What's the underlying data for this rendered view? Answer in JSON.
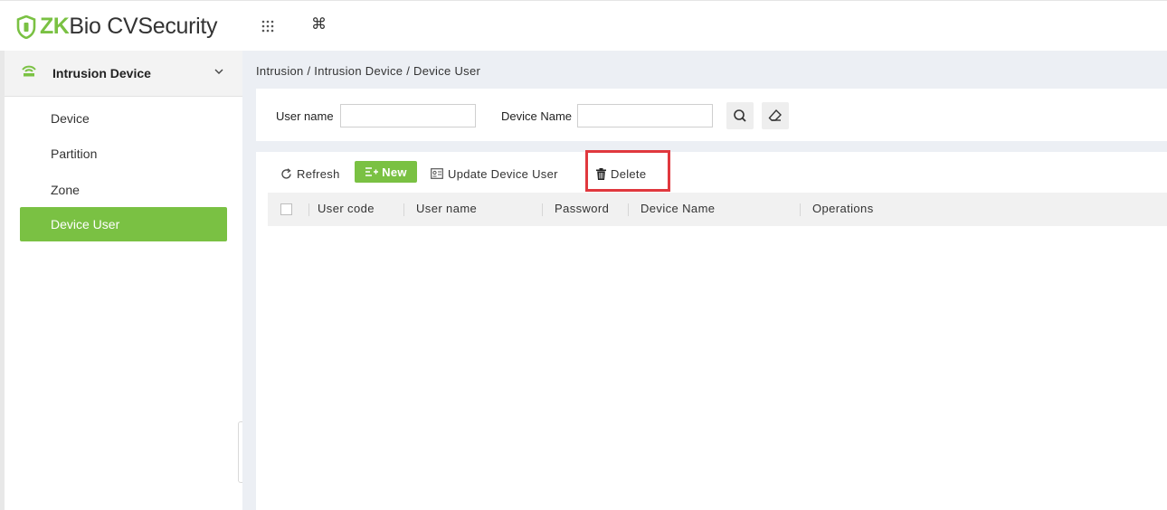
{
  "app": {
    "brand_zk": "ZK",
    "brand_rest": "Bio CVSecurity",
    "accent_color": "#7ac143",
    "highlight_color": "#e0383e"
  },
  "topbar": {
    "icons": [
      "apps-grid-icon",
      "command-icon"
    ],
    "command_glyph": "⌘"
  },
  "sidebar": {
    "header_label": "Intrusion Device",
    "items": [
      {
        "label": "Device",
        "active": false
      },
      {
        "label": "Partition",
        "active": false
      },
      {
        "label": "Zone",
        "active": false
      },
      {
        "label": "Device User",
        "active": true
      }
    ],
    "collapse_glyph": "«"
  },
  "breadcrumb": "Intrusion / Intrusion Device / Device User",
  "search": {
    "user_name_label": "User name",
    "user_name_value": "",
    "device_name_label": "Device Name",
    "device_name_value": ""
  },
  "toolbar": {
    "refresh_label": "Refresh",
    "new_label": "New",
    "update_label": "Update Device User",
    "delete_label": "Delete"
  },
  "table": {
    "columns": [
      "User code",
      "User name",
      "Password",
      "Device Name",
      "Operations"
    ],
    "rows": []
  }
}
